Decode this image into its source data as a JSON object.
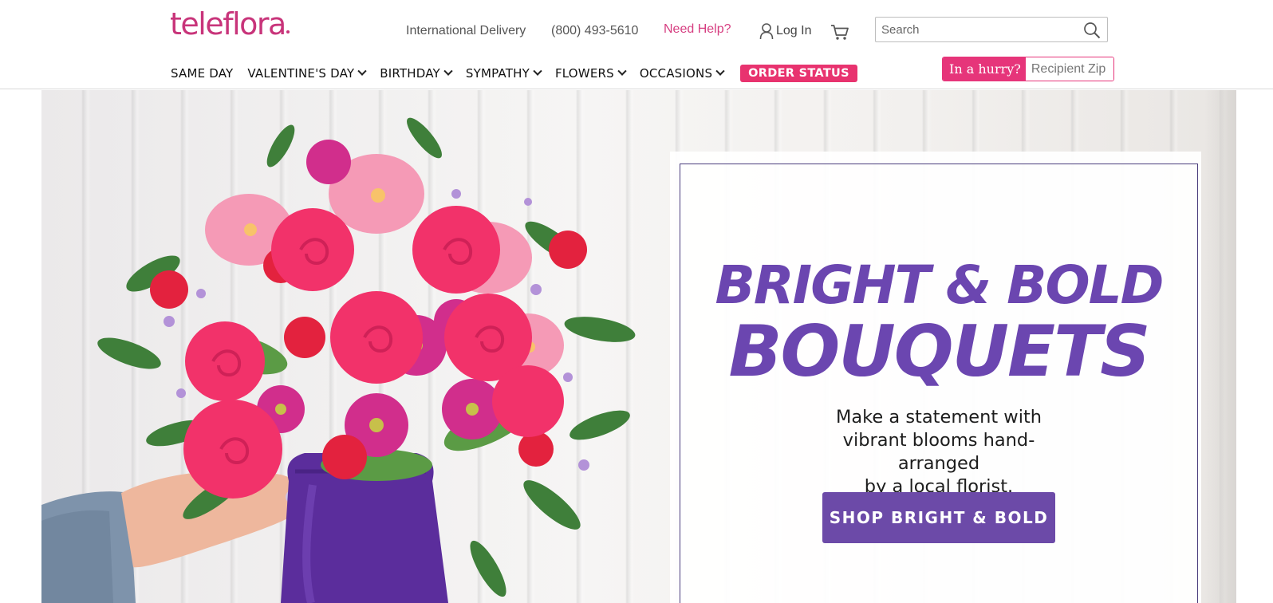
{
  "header": {
    "logo_text": "teleflora",
    "utility_links": {
      "international": "International Delivery",
      "phone": "(800) 493-5610",
      "help": "Need Help?",
      "login": "Log In"
    },
    "search": {
      "placeholder": "Search"
    },
    "nav": [
      {
        "label": "SAME DAY",
        "has_dropdown": false
      },
      {
        "label": "VALENTINE'S DAY",
        "has_dropdown": true
      },
      {
        "label": "BIRTHDAY",
        "has_dropdown": true
      },
      {
        "label": "SYMPATHY",
        "has_dropdown": true
      },
      {
        "label": "FLOWERS",
        "has_dropdown": true
      },
      {
        "label": "OCCASIONS",
        "has_dropdown": true
      }
    ],
    "order_status": "ORDER STATUS",
    "hurry": {
      "label": "In a hurry?",
      "placeholder": "Recipient Zip"
    }
  },
  "hero": {
    "headline_line1": "BRIGHT & BOLD",
    "headline_line2": "BOUQUETS",
    "subcopy_line1": "Make a statement with",
    "subcopy_line2": "vibrant blooms hand-arranged",
    "subcopy_line3": "by a local florist.",
    "cta": "SHOP BRIGHT & BOLD"
  },
  "colors": {
    "brand_pink": "#c8347a",
    "accent_pink": "#e8336f",
    "promo_purple": "#6b46b0",
    "button_purple": "#6c4aa8"
  },
  "icons": [
    "user-icon",
    "cart-icon",
    "search-icon",
    "chevron-down-icon"
  ]
}
